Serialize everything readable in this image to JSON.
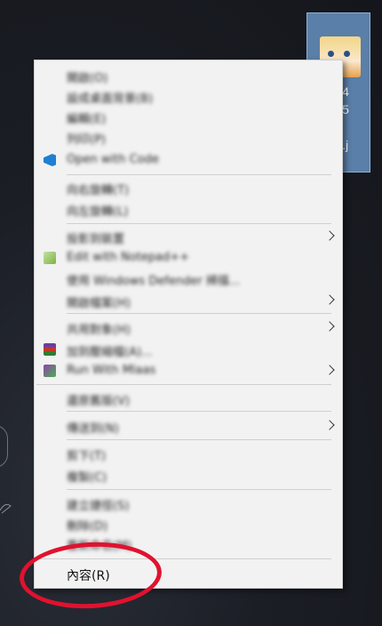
{
  "desktop": {
    "file_name": "41e04\n37e85\nb3e8\n71[1].j\ng"
  },
  "menu": {
    "items": [
      {
        "label": "開啟(O)",
        "icon": null,
        "submenu": false
      },
      {
        "label": "設成桌面背景(B)",
        "icon": null,
        "submenu": false
      },
      {
        "label": "編輯(E)",
        "icon": null,
        "submenu": false
      },
      {
        "label": "列印(P)",
        "icon": null,
        "submenu": false
      },
      {
        "label": "Open with Code",
        "icon": "vscode-icon",
        "icon_color": "#1f7fd1",
        "submenu": false
      },
      {
        "label": "向右旋轉(T)",
        "icon": null,
        "submenu": false
      },
      {
        "label": "向左旋轉(L)",
        "icon": null,
        "submenu": false
      },
      {
        "label": "投影到裝置",
        "icon": null,
        "submenu": true
      },
      {
        "label": "Edit with Notepad++",
        "icon": "notepadpp-icon",
        "icon_color": "#8bc34a",
        "submenu": false
      },
      {
        "label": "使用 Windows Defender 掃描...",
        "icon": null,
        "submenu": false
      },
      {
        "label": "開啟檔案(H)",
        "icon": null,
        "submenu": true
      },
      {
        "label": "共用對象(H)",
        "icon": null,
        "submenu": true
      },
      {
        "label": "加到壓縮檔(A)...",
        "icon": "winrar-icon",
        "icon_color": "#7a3b8f",
        "submenu": false
      },
      {
        "label": "Run With Mlaas",
        "icon": "mlaas-icon",
        "icon_color": "#4caf50",
        "submenu": true
      },
      {
        "label": "還原舊版(V)",
        "icon": null,
        "submenu": false
      },
      {
        "label": "傳送到(N)",
        "icon": null,
        "submenu": true
      },
      {
        "label": "剪下(T)",
        "icon": null,
        "submenu": false
      },
      {
        "label": "複製(C)",
        "icon": null,
        "submenu": false
      },
      {
        "label": "建立捷徑(S)",
        "icon": null,
        "submenu": false
      },
      {
        "label": "刪除(D)",
        "icon": null,
        "submenu": false
      },
      {
        "label": "重新命名(M)",
        "icon": null,
        "submenu": false
      },
      {
        "label": "內容(R)",
        "icon": null,
        "submenu": false
      }
    ]
  },
  "annotation": {
    "color": "#e0122f"
  }
}
